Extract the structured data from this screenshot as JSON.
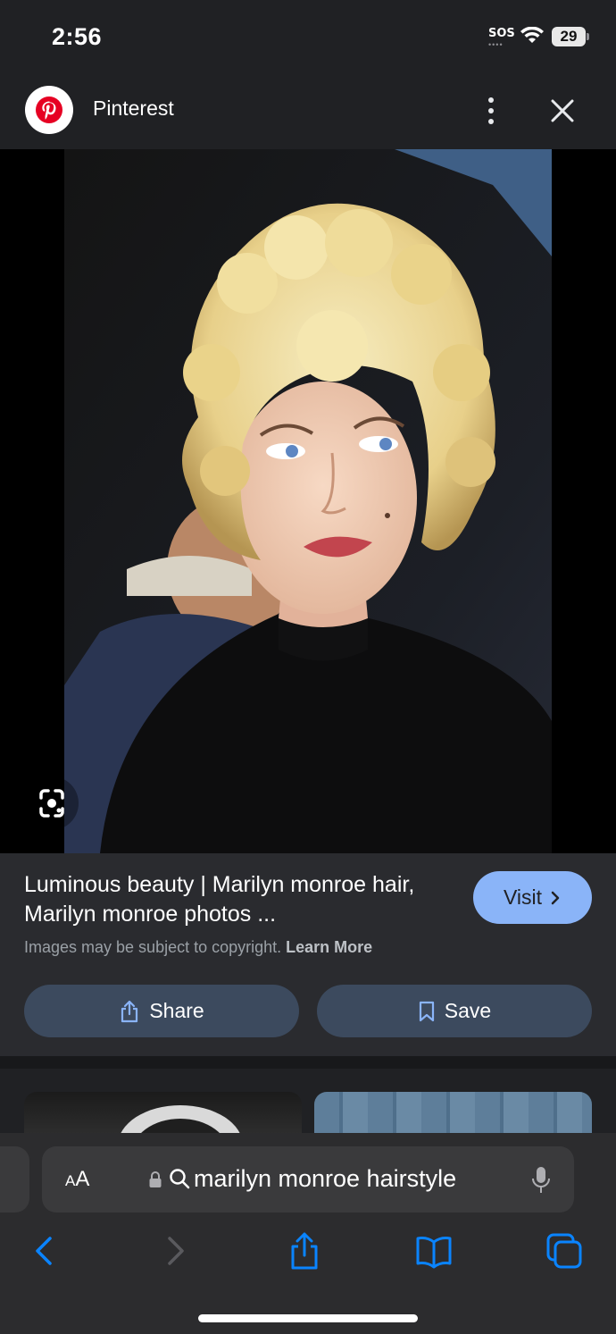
{
  "status_bar": {
    "time": "2:56",
    "sos": "SOS",
    "battery": "29"
  },
  "header": {
    "site_name": "Pinterest"
  },
  "result": {
    "title": "Luminous beauty | Marilyn monroe hair, Marilyn monroe photos ...",
    "visit_label": "Visit",
    "copyright_text": "Images may be subject to copyright.",
    "learn_more": "Learn More",
    "share_label": "Share",
    "save_label": "Save"
  },
  "browser": {
    "aa_large": "A",
    "aa_small": "A",
    "url": "marilyn monroe hairstyle"
  },
  "icons": {
    "pinterest": "pinterest-logo",
    "more": "more-vertical-icon",
    "close": "close-icon",
    "lens": "lens-icon",
    "share": "share-icon",
    "bookmark": "bookmark-icon",
    "lock": "lock-icon",
    "search": "search-icon",
    "mic": "mic-icon",
    "back": "back-icon",
    "forward": "forward-icon",
    "bookmarks": "bookmarks-icon",
    "tabs": "tabs-icon"
  },
  "colors": {
    "accent": "#8ab4f8",
    "pinterest_red": "#e60023",
    "ios_blue": "#0a84ff"
  }
}
